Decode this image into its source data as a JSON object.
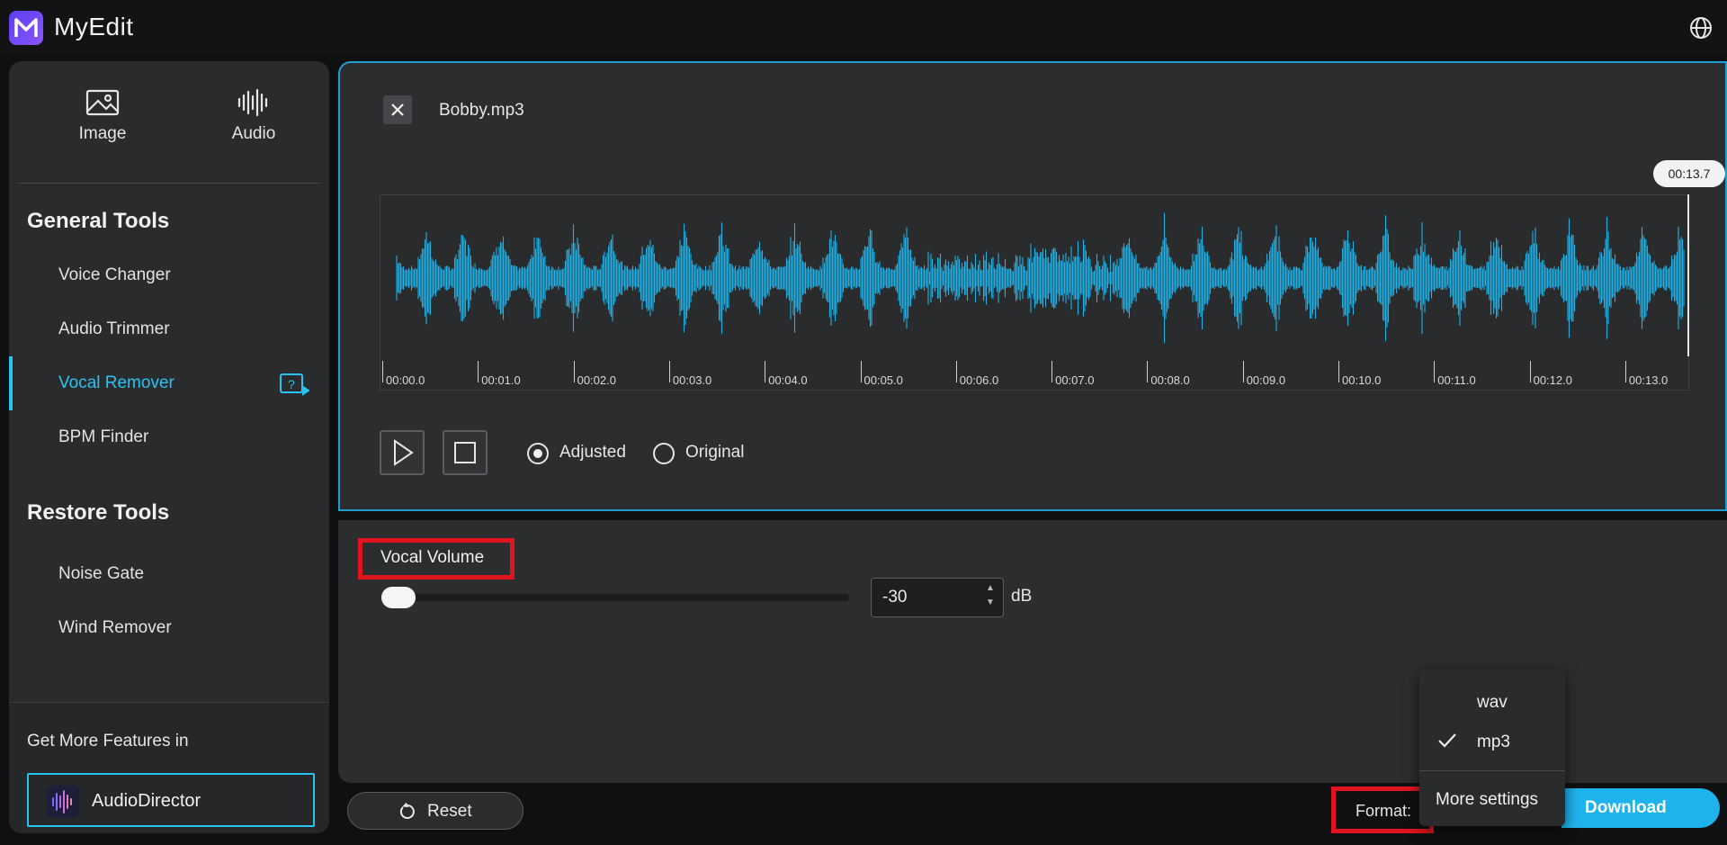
{
  "app": {
    "name": "MyEdit"
  },
  "sidebar": {
    "tabs": [
      {
        "label": "Image",
        "icon": "image-icon"
      },
      {
        "label": "Audio",
        "icon": "audio-wave-icon"
      }
    ],
    "general_title": "General Tools",
    "general_items": [
      {
        "label": "Voice Changer"
      },
      {
        "label": "Audio Trimmer"
      },
      {
        "label": "Vocal Remover",
        "active": true
      },
      {
        "label": "BPM Finder"
      }
    ],
    "restore_title": "Restore Tools",
    "restore_items": [
      {
        "label": "Noise Gate"
      },
      {
        "label": "Wind Remover"
      }
    ],
    "more_features": "Get More Features in",
    "promo_app": "AudioDirector"
  },
  "player": {
    "filename": "Bobby.mp3",
    "current_time": "00:13.7",
    "ticks": [
      "00:00.0",
      "00:01.0",
      "00:02.0",
      "00:03.0",
      "00:04.0",
      "00:05.0",
      "00:06.0",
      "00:07.0",
      "00:08.0",
      "00:09.0",
      "00:10.0",
      "00:11.0",
      "00:12.0",
      "00:13.0"
    ],
    "mode_adjusted": "Adjusted",
    "mode_original": "Original",
    "selected_mode": "Adjusted"
  },
  "vocal": {
    "label": "Vocal Volume",
    "value": "-30",
    "unit": "dB",
    "slider_fraction": 0.0
  },
  "footer": {
    "reset_label": "Reset",
    "format_label": "Format:",
    "format_options": [
      "wav",
      "mp3"
    ],
    "format_selected": "mp3",
    "more_settings": "More settings",
    "download_label": "Download"
  },
  "colors": {
    "accent": "#29c3f2",
    "wave": "#1fb0e6",
    "highlight": "#e0141e",
    "brand": "#6a4cf5"
  }
}
